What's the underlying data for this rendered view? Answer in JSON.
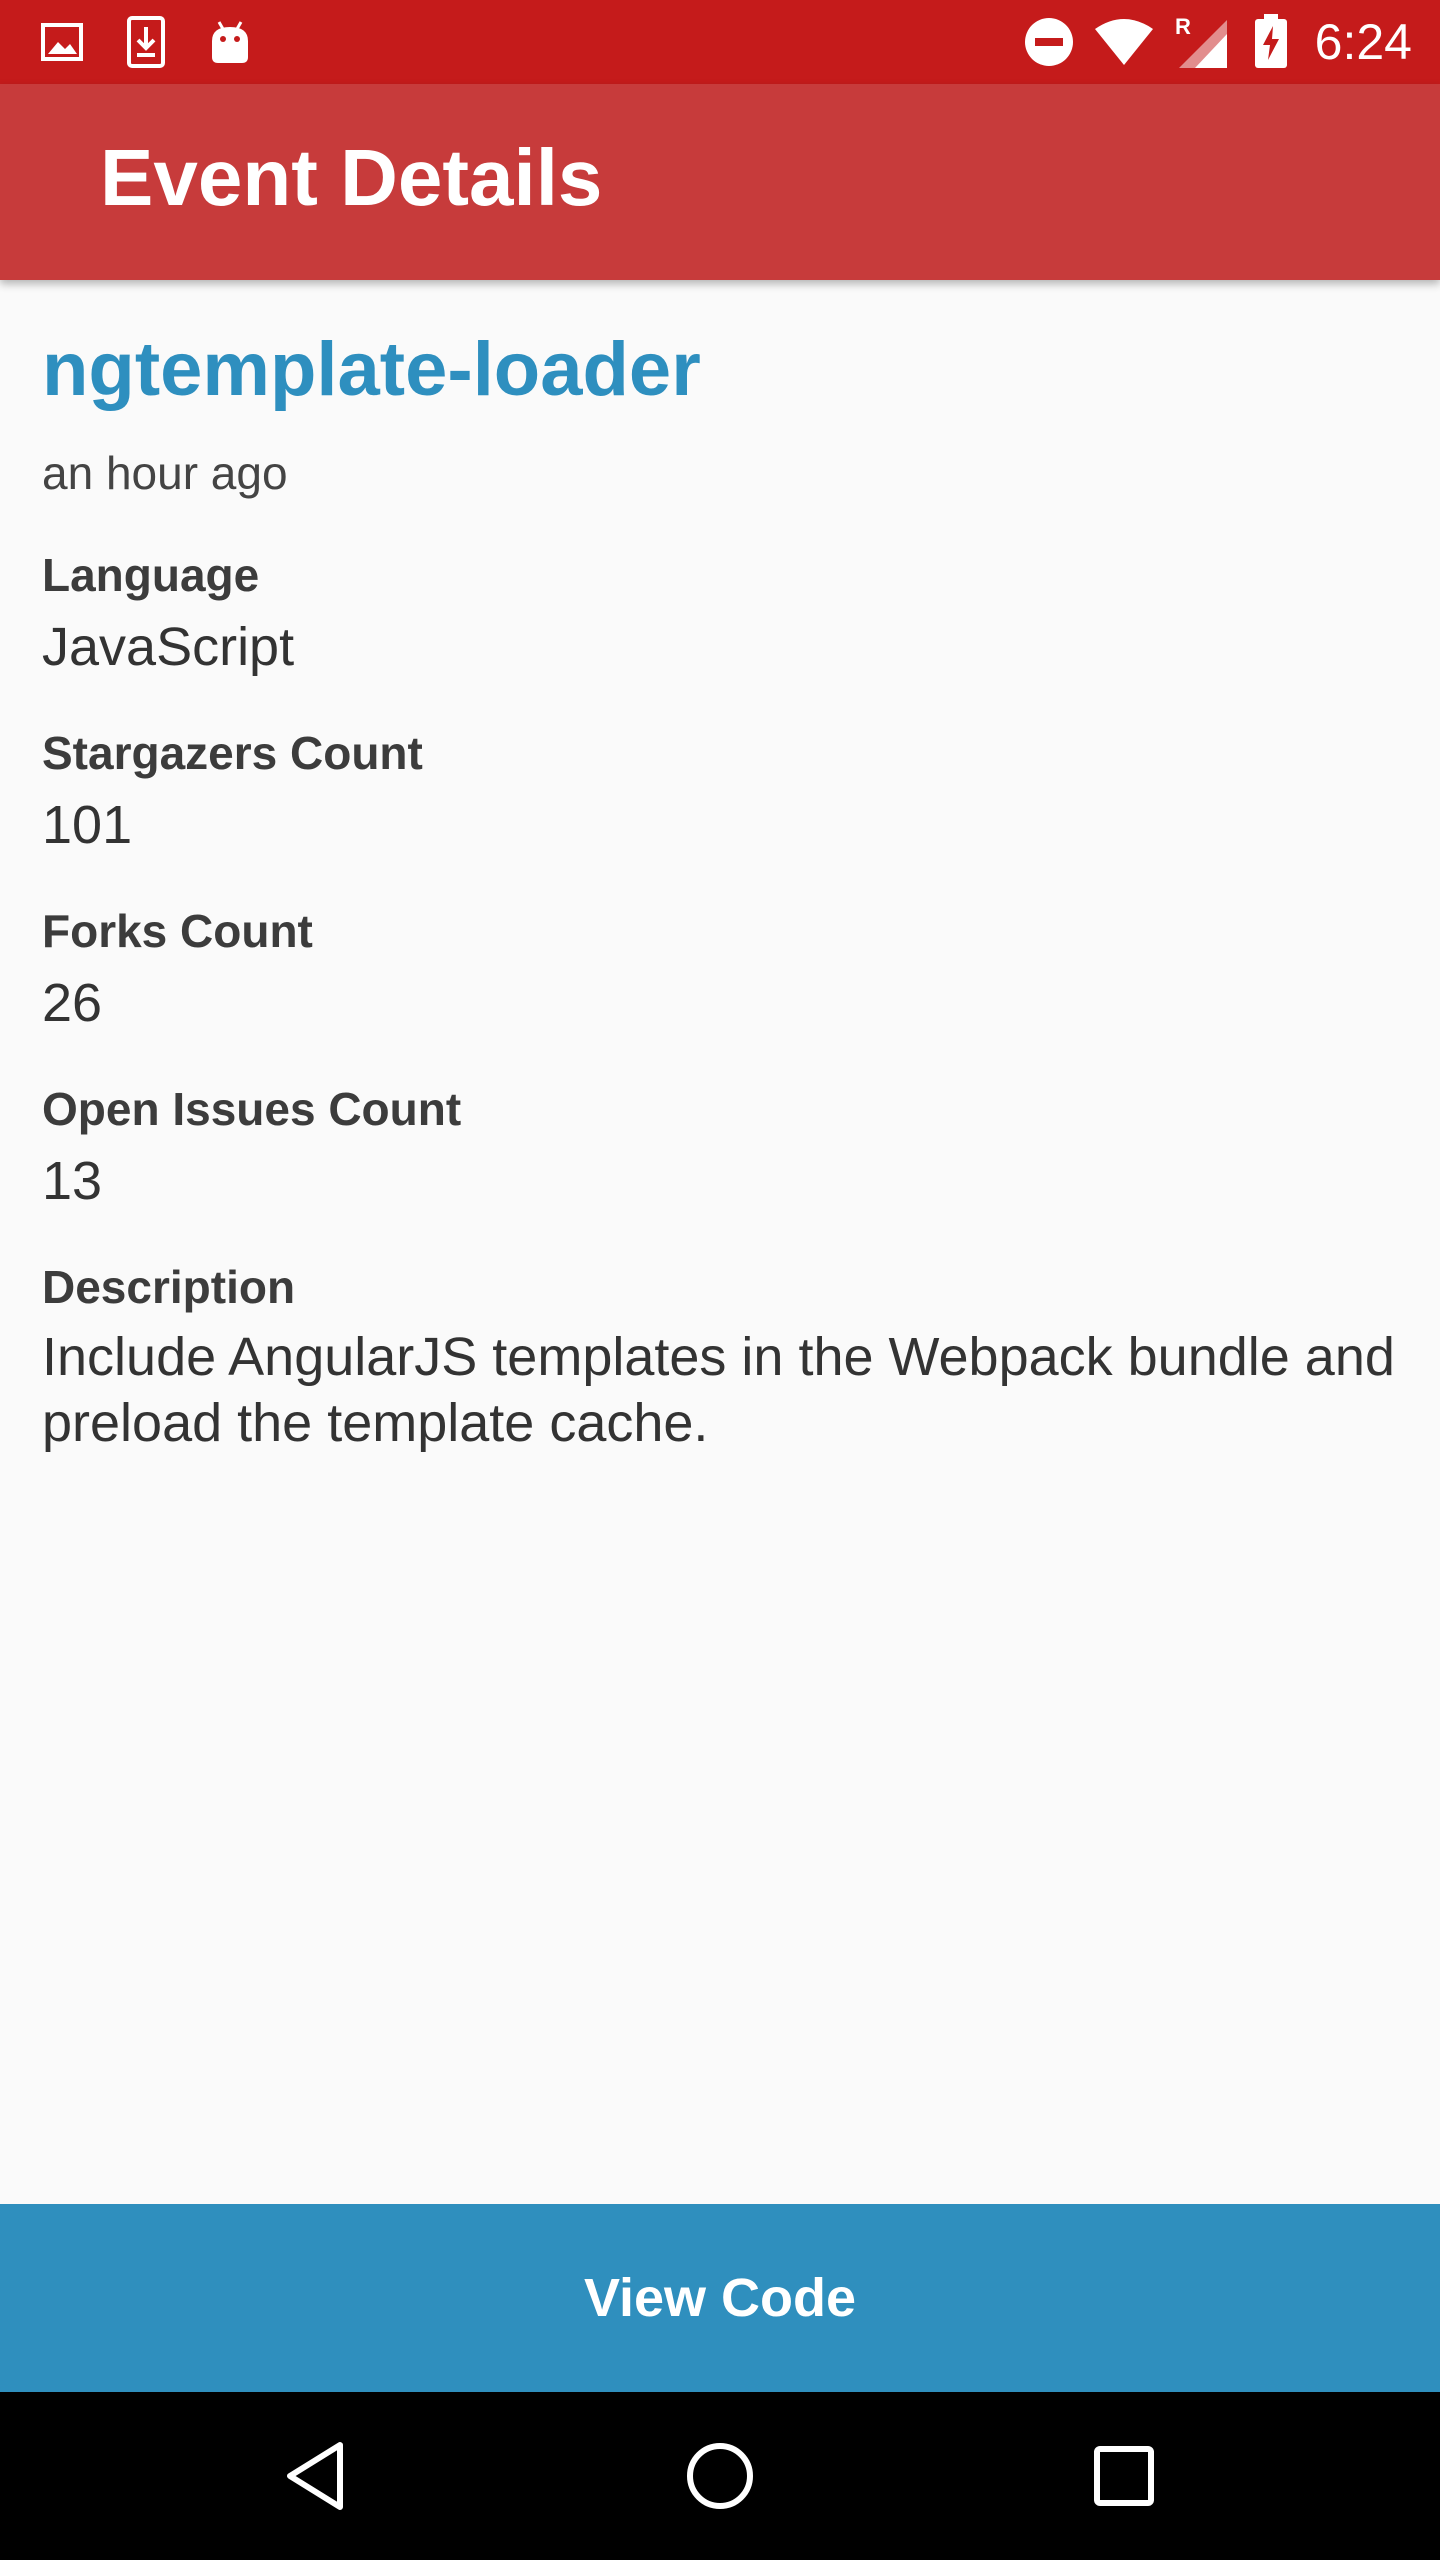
{
  "status_bar": {
    "time": "6:24",
    "left_icons": [
      "image-icon",
      "download-icon",
      "android-icon"
    ],
    "right_icons": [
      "do-not-disturb-icon",
      "wifi-icon",
      "signal-icon",
      "battery-charging-icon"
    ],
    "roaming_indicator": "R",
    "color": "#c51b1b"
  },
  "app_bar": {
    "title": "Event Details",
    "color": "#c73b3b"
  },
  "event": {
    "repo_name": "ngtemplate-loader",
    "time_ago": "an hour ago",
    "fields": [
      {
        "label": "Language",
        "value": "JavaScript"
      },
      {
        "label": "Stargazers Count",
        "value": "101"
      },
      {
        "label": "Forks Count",
        "value": "26"
      },
      {
        "label": "Open Issues Count",
        "value": "13"
      },
      {
        "label": "Description",
        "value": "Include AngularJS templates in the Webpack bundle and preload the template cache."
      }
    ]
  },
  "actions": {
    "view_code_label": "View Code",
    "color": "#2f8fbe"
  },
  "nav_bar": {
    "buttons": [
      "back-icon",
      "home-icon",
      "recents-icon"
    ]
  }
}
